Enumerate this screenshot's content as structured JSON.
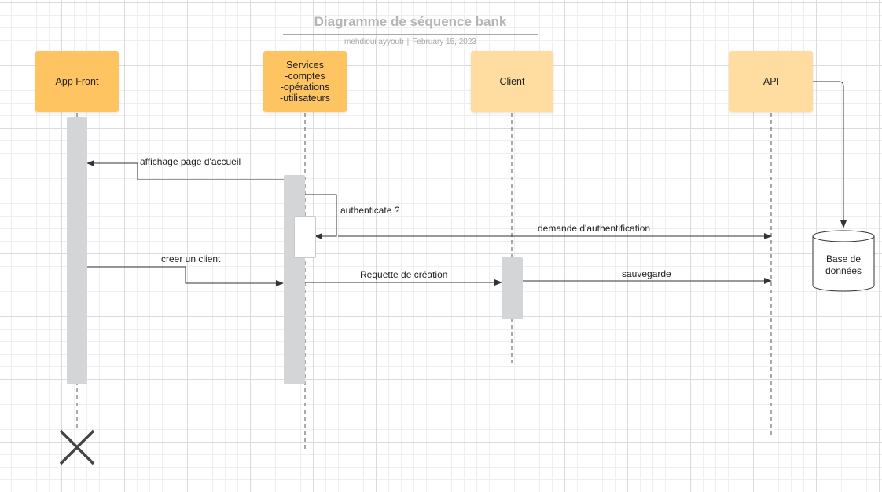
{
  "document": {
    "title": "Diagramme de séquence bank",
    "author": "mehdioui ayyoub",
    "date": "February 15, 2023"
  },
  "participants": [
    {
      "id": "app-front",
      "label": "App Front"
    },
    {
      "id": "services",
      "label": "Services\n-comptes\n-opérations\n-utilisateurs"
    },
    {
      "id": "client",
      "label": "Client"
    },
    {
      "id": "api",
      "label": "API"
    }
  ],
  "database": {
    "label": "Base de\ndonnées"
  },
  "messages": [
    {
      "id": "affichage",
      "label": "affichage page d'accueil"
    },
    {
      "id": "authenticate",
      "label": "authenticate ?"
    },
    {
      "id": "demande",
      "label": "demande d'authentification"
    },
    {
      "id": "creer",
      "label": "creer un client"
    },
    {
      "id": "requette",
      "label": "Requette de création"
    },
    {
      "id": "sauvegarde",
      "label": "sauvegarde"
    }
  ],
  "icons": {
    "destruction": "close-icon"
  },
  "colors": {
    "participant_dark": "#ffc462",
    "participant_light": "#ffdda0",
    "activation": "#d4d5d6",
    "line": "#333333"
  }
}
